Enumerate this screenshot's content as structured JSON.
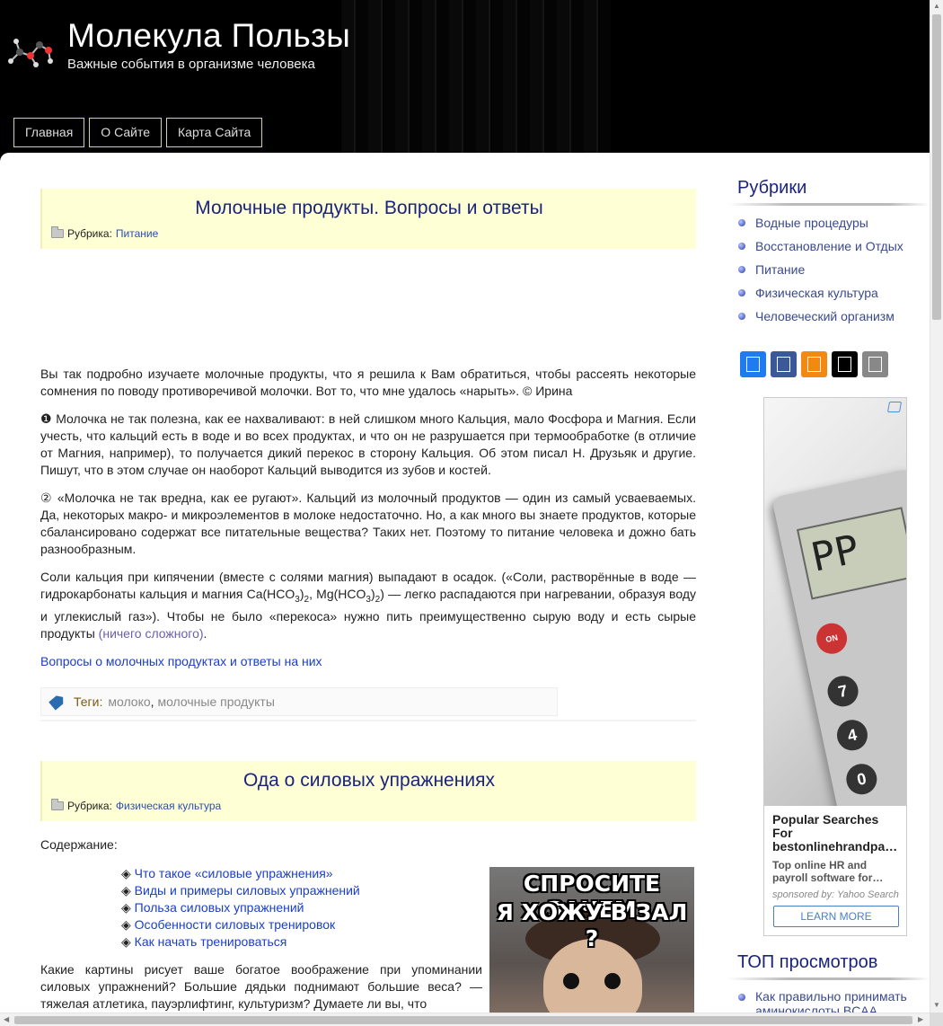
{
  "header": {
    "title": "Молекула Пользы",
    "tagline": "Важные события в организме человека",
    "nav": [
      "Главная",
      "О Сайте",
      "Карта Сайта"
    ]
  },
  "post1": {
    "title": "Молочные продукты. Вопросы и ответы",
    "rubric_label": "Рубрика:",
    "rubric": "Питание",
    "p1": "Вы так подробно изучаете молочные продукты, что я решила к Вам обратиться, чтобы рассеять некоторые сомнения по поводу противоречивой молочки. Вот то, что мне удалось «нарыть». © Ирина",
    "p2": "❶ Молочка не так полезна, как ее нахваливают: в ней слишком много Кальция, мало Фосфора и Магния. Если учесть, что кальций есть в воде и во всех продуктах, и что он не разрушается при термообработке (в отличие от Магния, например), то получается дикий перекос в сторону Кальция. Об этом писал Н. Друзьяк и другие. Пишут, что в этом случае он наоборот Кальций выводится из зубов и костей.",
    "p3": "② «Молочка не так вредна, как ее ругают». Кальций из молочный продуктов — один из самый усваеваемых. Да, некоторых макро- и микроэлементов в молоке недостаточно. Но, а как много вы знаете продуктов, которые сбалансировано содержат все питательные вещества? Таких нет. Поэтому то питание человека и дожно бать разнообразным.",
    "p4_a": "Соли кальция при кипячении (вместе с солями магния) выпадают в осадок. («Соли, растворённые в воде — гидрокарбонаты кальция и магния Ca(HCO",
    "p4_b": "3",
    "p4_c": ")",
    "p4_d": "2",
    "p4_e": ", Mg(HCO",
    "p4_f": ") — легко распадаются при нагревании, образуя воду и углекислый газ»). Чтобы не было «перекоса» нужно пить преимущественно сырую воду и есть сырые продукты ",
    "p4_link": "(ничего сложного)",
    "p4_end": ".",
    "more_link": "Вопросы о молочных продуктах и ответы на них",
    "tags_label": "Теги:",
    "tags": [
      "молоко",
      "молочные продукты"
    ],
    "tags_sep": ", "
  },
  "post2": {
    "title": "Ода о силовых упражнениях",
    "rubric_label": "Рубрика:",
    "rubric": "Физическая культура",
    "toc_title": "Содержание:",
    "toc_bullet": "◈",
    "toc": [
      "Что такое «силовые упражнения»",
      "Виды и примеры силовых упражнений",
      "Польза силовых упражнений",
      "Особенности силовых тренировок",
      "Как начать тренироваться"
    ],
    "image_caption_1": "СПРОСИТЕ ЗАЧЕМ",
    "image_caption_2": "Я ХОЖУ В ЗАЛ ?",
    "intro": "Какие картины рисует ваше богатое воображение при упоминании силовых упражнений? Большие дядьки поднимают большие веса? — тяжелая атлетика, пауэрлифтинг, культуризм? Думаете ли вы, что"
  },
  "sidebar": {
    "rubrics_title": "Рубрики",
    "rubrics": [
      "Водные процедуры",
      "Восстановление и Отдых",
      "Питание",
      "Физическая культура",
      "Человеческий организм"
    ],
    "share_colors": [
      "#1e7cf0",
      "#3b5998",
      "#f28a11",
      "#000000",
      "#888888"
    ],
    "ad": {
      "calc_display": "PP",
      "key_on": "ON",
      "key_on_ce": "ON C-CE",
      "keys": [
        "7",
        "4",
        "0"
      ],
      "headline": "Popular Searches For bestonlinehrandpa…",
      "sub": "Top online HR and payroll software for…",
      "sponsor": "sponsored by: Yahoo Search",
      "button": "LEARN MORE"
    },
    "top_title": "ТОП просмотров",
    "top": [
      "Как правильно принимать аминокислоты BCAA"
    ]
  }
}
